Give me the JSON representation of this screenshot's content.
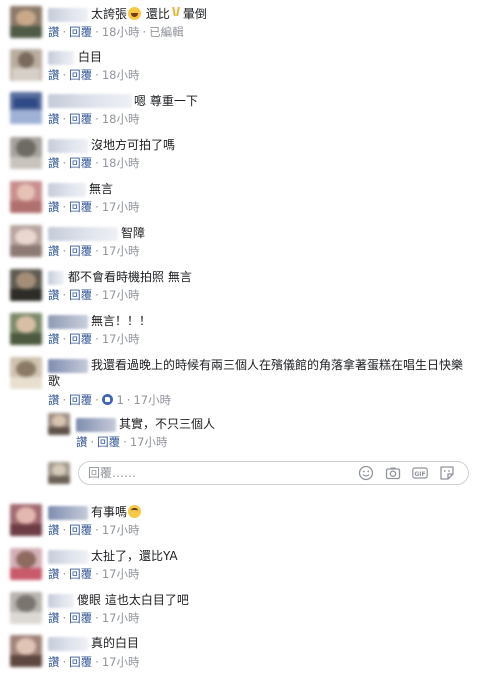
{
  "actions": {
    "like": "讚",
    "reply": "回覆",
    "edited": "已編輯"
  },
  "comments": [
    {
      "text_before": "太誇張",
      "text_middle": "還比",
      "text_after": "暈倒",
      "time": "18小時"
    },
    {
      "text": "白目",
      "time": "18小時"
    },
    {
      "text": "嗯 尊重一下",
      "time": "18小時"
    },
    {
      "text": "沒地方可拍了嗎",
      "time": "18小時"
    },
    {
      "text": "無言",
      "time": "17小時"
    },
    {
      "text": "智障",
      "time": "17小時"
    },
    {
      "text": "都不會看時機拍照 無言",
      "time": "17小時"
    },
    {
      "text": "無言！！！",
      "time": "17小時"
    },
    {
      "text": "我還看過晚上的時候有兩三個人在殯儀館的角落拿著蛋糕在唱生日快樂歌",
      "time": "17小時",
      "like_count": "1"
    },
    {
      "text": "其實，不只三個人",
      "time": "17小時"
    },
    {
      "text": "有事嗎",
      "time": "17小時"
    },
    {
      "text": "太扯了，還比YA",
      "time": "17小時"
    },
    {
      "text": "傻眼 這也太白目了吧",
      "time": "17小時"
    },
    {
      "text": "真的白目",
      "time": "17小時"
    }
  ],
  "reply_box": {
    "placeholder": "回覆……"
  },
  "icons": [
    "laughing-emoji-icon",
    "victory-hand-emoji-icon",
    "eye-roll-emoji-icon",
    "like-reaction-icon",
    "emoji-picker-icon",
    "camera-icon",
    "gif-icon",
    "sticker-icon"
  ],
  "colors": {
    "link": "#365899",
    "muted": "#90949c",
    "text": "#1c1e21",
    "like_blue": "#4267b2"
  }
}
